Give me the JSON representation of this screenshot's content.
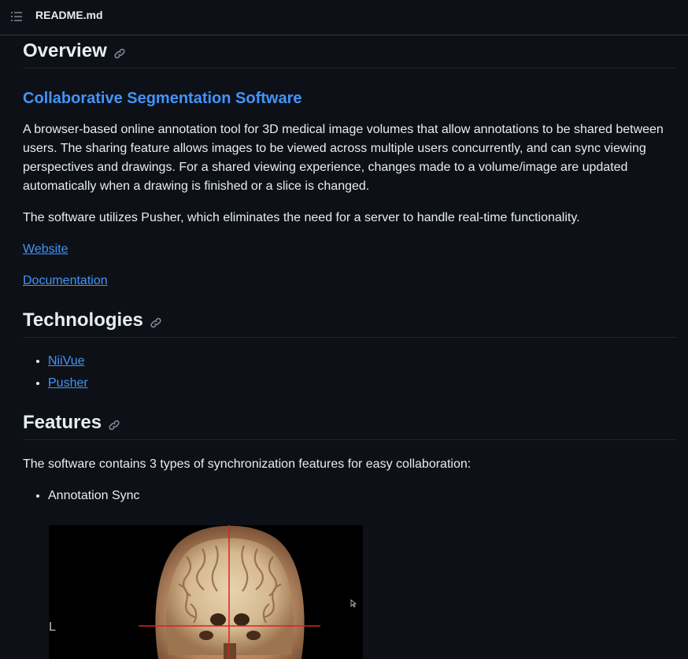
{
  "header": {
    "filename": "README.md",
    "toc_icon": "list-unordered-icon"
  },
  "overview": {
    "heading": "Overview",
    "subheading": "Collaborative Segmentation Software",
    "description": "A browser-based online annotation tool for 3D medical image volumes that allow annotations to be shared between users. The sharing feature allows images to be viewed across multiple users concurrently, and can sync viewing perspectives and drawings. For a shared viewing experience, changes made to a volume/image are updated automatically when a drawing is finished or a slice is changed.",
    "pusher_note": "The software utilizes Pusher, which eliminates the need for a server to handle real-time functionality.",
    "links": {
      "website": "Website",
      "documentation": "Documentation"
    }
  },
  "technologies": {
    "heading": "Technologies",
    "items": [
      "NiiVue",
      "Pusher"
    ]
  },
  "features": {
    "heading": "Features",
    "intro": "The software contains 3 types of synchronization features for easy collaboration:",
    "items": [
      "Annotation Sync"
    ]
  },
  "image_viewer": {
    "orientation_label": "L"
  },
  "colors": {
    "background": "#0d1117",
    "text": "#e6edf3",
    "link": "#4493f8",
    "border": "#21262d",
    "crosshair": "#e02020"
  },
  "icons": {
    "anchor": "link-icon"
  }
}
